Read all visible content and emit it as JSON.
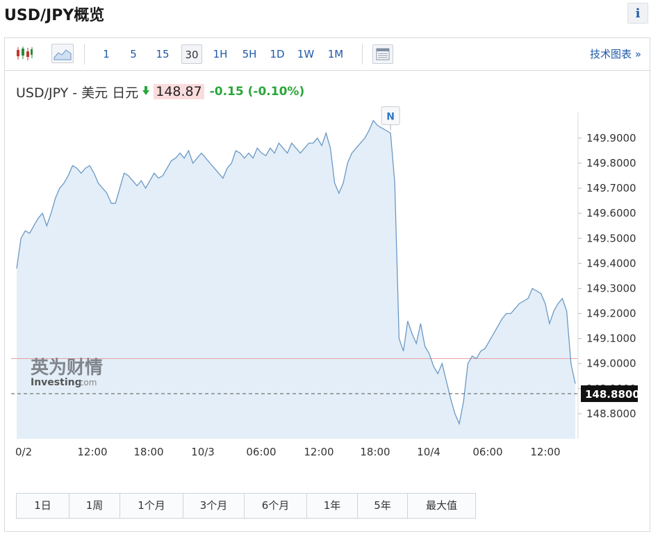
{
  "page": {
    "title": "USD/JPY概览",
    "info_label": "i"
  },
  "toolbar": {
    "timeframes": [
      "1",
      "5",
      "15",
      "30",
      "1H",
      "5H",
      "1D",
      "1W",
      "1M"
    ],
    "active_timeframe": "30",
    "tech_link": "技术图表 »"
  },
  "quote": {
    "name": "USD/JPY - 美元 日元",
    "direction": "down",
    "price": "148.87",
    "change": "-0.15",
    "change_pct": "(-0.10%)"
  },
  "watermark": {
    "brand_cn": "英为财情",
    "brand_en": "Investing",
    "brand_suffix": ".com"
  },
  "range_buttons": [
    "1日",
    "1周",
    "1个月",
    "3个月",
    "6个月",
    "1年",
    "5年",
    "最大值"
  ],
  "chart_data": {
    "type": "area",
    "pair": "USD/JPY",
    "x_ticks": [
      "0/2",
      "12:00",
      "18:00",
      "10/3",
      "06:00",
      "12:00",
      "18:00",
      "10/4",
      "06:00",
      "12:00"
    ],
    "y_ticks": [
      "148.8000",
      "148.9000",
      "149.0000",
      "149.1000",
      "149.2000",
      "149.3000",
      "149.4000",
      "149.5000",
      "149.6000",
      "149.7000",
      "149.8000",
      "149.9000"
    ],
    "ylim": [
      148.7,
      149.98
    ],
    "last_value": "148.8800",
    "reference_line": 149.02,
    "news_markers": [
      {
        "label": "N",
        "index": 87
      },
      {
        "label": "N",
        "index": 178
      }
    ],
    "series": [
      {
        "values": [
          149.38,
          149.5,
          149.53,
          149.52,
          149.55,
          149.58,
          149.6,
          149.55,
          149.6,
          149.66,
          149.7,
          149.72,
          149.75,
          149.79,
          149.78,
          149.76,
          149.78,
          149.79,
          149.76,
          149.72,
          149.7,
          149.68,
          149.64,
          149.64,
          149.7,
          149.76,
          149.75,
          149.73,
          149.71,
          149.73,
          149.7,
          149.73,
          149.76,
          149.74,
          149.75,
          149.78,
          149.81,
          149.82,
          149.84,
          149.82,
          149.85,
          149.8,
          149.82,
          149.84,
          149.82,
          149.8,
          149.78,
          149.76,
          149.74,
          149.78,
          149.8,
          149.85,
          149.84,
          149.82,
          149.84,
          149.82,
          149.86,
          149.84,
          149.83,
          149.86,
          149.84,
          149.88,
          149.86,
          149.84,
          149.88,
          149.86,
          149.84,
          149.86,
          149.88,
          149.88,
          149.9,
          149.87,
          149.92,
          149.86,
          149.72,
          149.68,
          149.72,
          149.8,
          149.84,
          149.86,
          149.88,
          149.9,
          149.93,
          149.97,
          149.95,
          149.94,
          149.93,
          149.92,
          149.72,
          149.1,
          149.05,
          149.17,
          149.12,
          149.08,
          149.16,
          149.07,
          149.04,
          148.99,
          148.96,
          149.0,
          148.93,
          148.86,
          148.8,
          148.76,
          148.85,
          149.0,
          149.03,
          149.02,
          149.05,
          149.06,
          149.09,
          149.12,
          149.15,
          149.18,
          149.2,
          149.2,
          149.22,
          149.24,
          149.25,
          149.26,
          149.3,
          149.29,
          149.28,
          149.24,
          149.16,
          149.21,
          149.24,
          149.26,
          149.21,
          149.0,
          148.92
        ]
      }
    ]
  }
}
